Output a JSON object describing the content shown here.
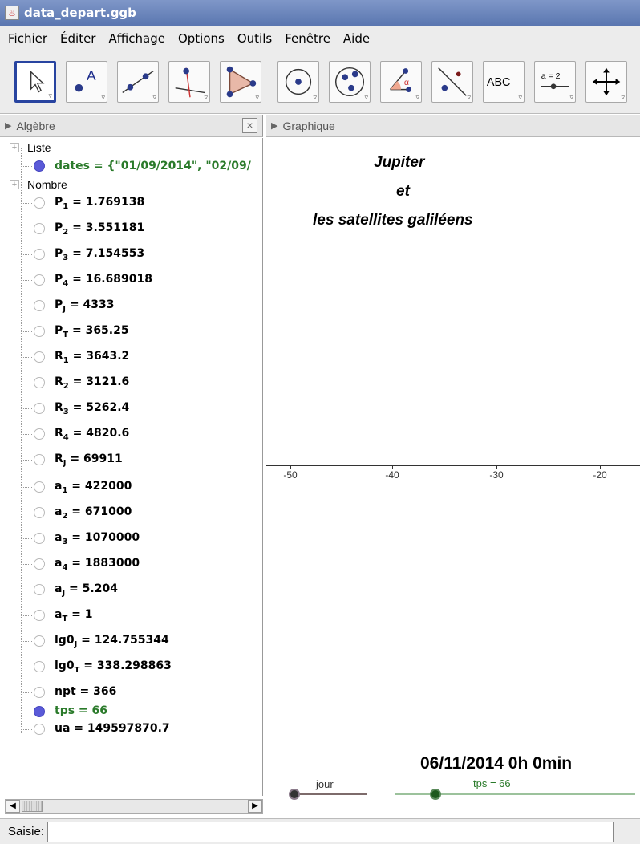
{
  "window": {
    "title": "data_depart.ggb"
  },
  "menu": [
    "Fichier",
    "Éditer",
    "Affichage",
    "Options",
    "Outils",
    "Fenêtre",
    "Aide"
  ],
  "toolbar": {
    "tools": [
      {
        "name": "move-tool-icon"
      },
      {
        "name": "point-tool-icon",
        "text": "A"
      },
      {
        "name": "line-tool-icon"
      },
      {
        "name": "perpendicular-tool-icon"
      },
      {
        "name": "polygon-tool-icon"
      },
      {
        "name": "circle-tool-icon"
      },
      {
        "name": "conic-tool-icon"
      },
      {
        "name": "angle-tool-icon",
        "text": "α"
      },
      {
        "name": "reflect-tool-icon"
      },
      {
        "name": "text-tool-icon",
        "text": "ABC"
      },
      {
        "name": "slider-tool-icon",
        "text": "a = 2"
      },
      {
        "name": "move-view-tool-icon"
      }
    ]
  },
  "algebra": {
    "header": "Algèbre",
    "close": "×",
    "categories": {
      "list": "Liste",
      "number": "Nombre"
    },
    "list_row": "dates = {\"01/09/2014\", \"02/09/",
    "rows": [
      {
        "base": "P",
        "sub": "1",
        "val": " = 1.769138"
      },
      {
        "base": "P",
        "sub": "2",
        "val": " = 3.551181"
      },
      {
        "base": "P",
        "sub": "3",
        "val": " = 7.154553"
      },
      {
        "base": "P",
        "sub": "4",
        "val": " = 16.689018"
      },
      {
        "base": "P",
        "sub": "J",
        "val": " = 4333"
      },
      {
        "base": "P",
        "sub": "T",
        "val": " = 365.25"
      },
      {
        "base": "R",
        "sub": "1",
        "val": " = 3643.2"
      },
      {
        "base": "R",
        "sub": "2",
        "val": " = 3121.6"
      },
      {
        "base": "R",
        "sub": "3",
        "val": " = 5262.4"
      },
      {
        "base": "R",
        "sub": "4",
        "val": " = 4820.6"
      },
      {
        "base": "R",
        "sub": "J",
        "val": " = 69911"
      },
      {
        "base": "a",
        "sub": "1",
        "val": " = 422000"
      },
      {
        "base": "a",
        "sub": "2",
        "val": " = 671000"
      },
      {
        "base": "a",
        "sub": "3",
        "val": " = 1070000"
      },
      {
        "base": "a",
        "sub": "4",
        "val": " = 1883000"
      },
      {
        "base": "a",
        "sub": "J",
        "val": " = 5.204"
      },
      {
        "base": "a",
        "sub": "T",
        "val": " = 1"
      },
      {
        "base": "lg0",
        "sub": "J",
        "val": " = 124.755344"
      },
      {
        "base": "lg0",
        "sub": "T",
        "val": " = 338.298863"
      },
      {
        "base": "npt",
        "sub": "",
        "val": " = 366"
      },
      {
        "base": "tps",
        "sub": "",
        "val": " = 66",
        "green": true
      },
      {
        "base": "ua",
        "sub": "",
        "val": " = 149597870.7"
      }
    ]
  },
  "graphics": {
    "header": "Graphique",
    "title_lines": [
      "Jupiter",
      "et",
      "les satellites galiléens"
    ],
    "ticks": [
      "-50",
      "-40",
      "-30",
      "-20"
    ],
    "date": "06/11/2014  0h 0min",
    "slider_jour_label": "jour",
    "slider_tps_label": "tps = 66"
  },
  "input": {
    "label": "Saisie:",
    "value": ""
  }
}
